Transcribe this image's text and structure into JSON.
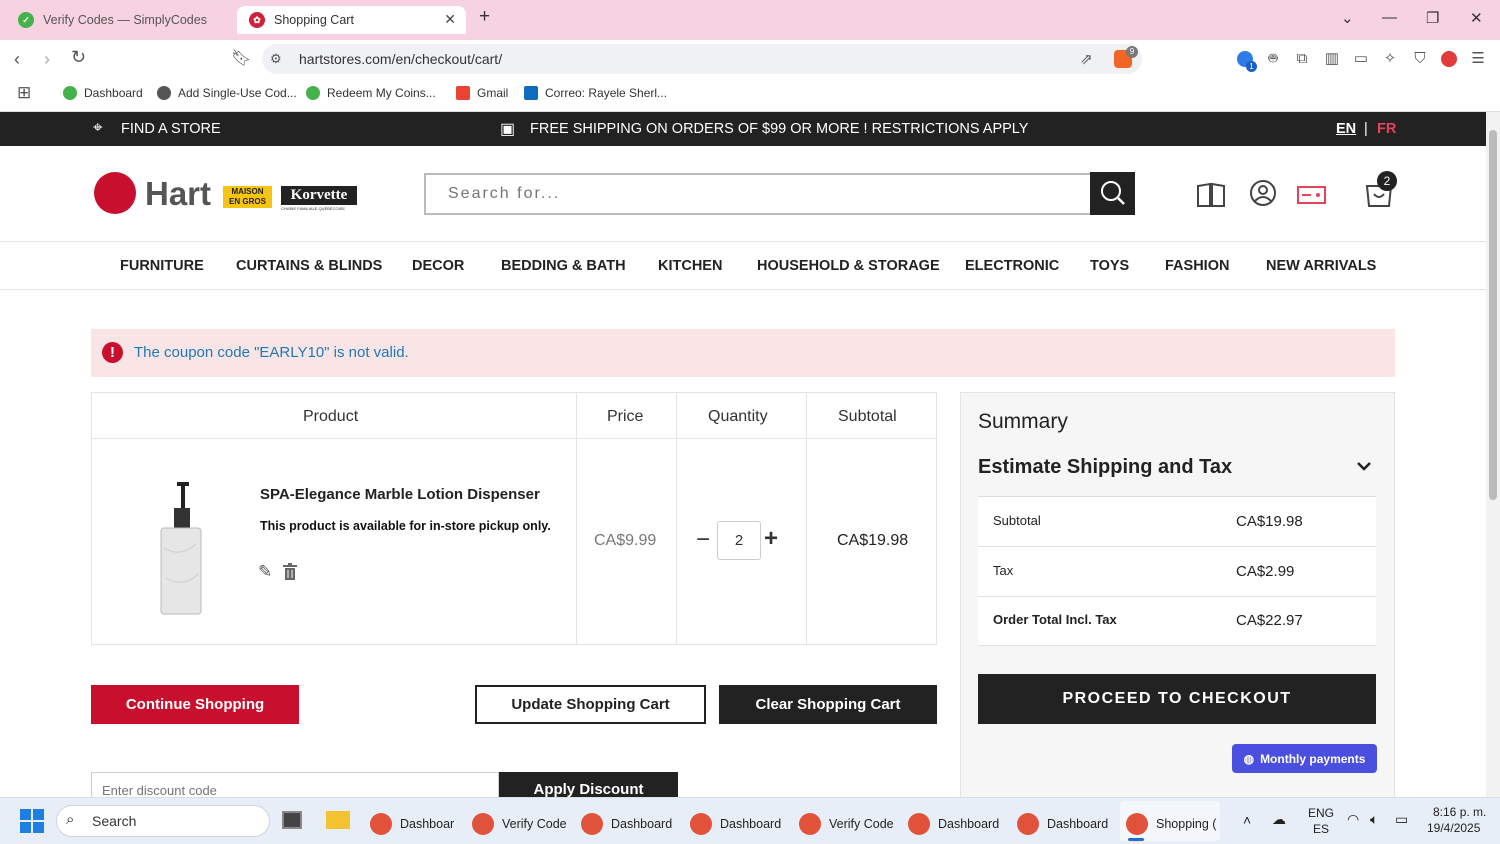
{
  "browser": {
    "tabs": [
      {
        "title": "Verify Codes — SimplyCodes",
        "active": false
      },
      {
        "title": "Shopping Cart",
        "active": true
      }
    ],
    "url": "hartstores.com/en/checkout/cart/",
    "bookmarks": [
      "Dashboard",
      "Add Single-Use Cod...",
      "Redeem My Coins...",
      "Gmail",
      "Correo: Rayele Sherl..."
    ],
    "extension_badge": "9",
    "ext_badge_blue": "1"
  },
  "site": {
    "top_strip": {
      "find_store": "FIND A STORE",
      "shipping": "FREE SHIPPING ON ORDERS OF $99 OR MORE ! RESTRICTIONS APPLY",
      "lang_en": "EN",
      "lang_sep": "|",
      "lang_fr": "FR"
    },
    "logo": {
      "hart": "Hart",
      "maison": "MAISON",
      "engros": "EN GROS",
      "korvette": "Korvette",
      "korvette_sub": "CHAÎNE FAMILIALE QUÉBÉCOISE"
    },
    "search": {
      "placeholder": "Search for..."
    },
    "cart_count": "2",
    "nav": [
      "FURNITURE",
      "CURTAINS & BLINDS",
      "DECOR",
      "BEDDING & BATH",
      "KITCHEN",
      "HOUSEHOLD & STORAGE",
      "ELECTRONIC",
      "TOYS",
      "FASHION",
      "NEW ARRIVALS"
    ],
    "alert": "The coupon code \"EARLY10\" is not valid.",
    "cart": {
      "headers": {
        "product": "Product",
        "price": "Price",
        "quantity": "Quantity",
        "subtotal": "Subtotal"
      },
      "item": {
        "name": "SPA-Elegance Marble Lotion Dispenser",
        "note": "This product is available for in-store pickup only.",
        "price": "CA$9.99",
        "qty": "2",
        "subtotal": "CA$19.98"
      }
    },
    "buttons": {
      "continue": "Continue Shopping",
      "update": "Update Shopping Cart",
      "clear": "Clear Shopping Cart",
      "apply": "Apply Discount",
      "discount_placeholder": "Enter discount code"
    },
    "summary": {
      "title": "Summary",
      "estimate": "Estimate Shipping and Tax",
      "rows": [
        {
          "label": "Subtotal",
          "value": "CA$19.98"
        },
        {
          "label": "Tax",
          "value": "CA$2.99"
        },
        {
          "label": "Order Total Incl. Tax",
          "value": "CA$22.97"
        }
      ],
      "checkout": "PROCEED TO CHECKOUT",
      "monthly": "Monthly payments"
    }
  },
  "taskbar": {
    "search": "Search",
    "items": [
      "Dashboar",
      "Verify Code",
      "Dashboard",
      "Dashboard",
      "Verify Code",
      "Dashboard",
      "Dashboard",
      "Shopping ("
    ],
    "lang1": "ENG",
    "lang2": "ES",
    "time": "8:16 p. m.",
    "date": "19/4/2025"
  },
  "colors": {
    "brand_red": "#c8102e",
    "dark": "#222222",
    "link_blue": "#1f79b8"
  }
}
